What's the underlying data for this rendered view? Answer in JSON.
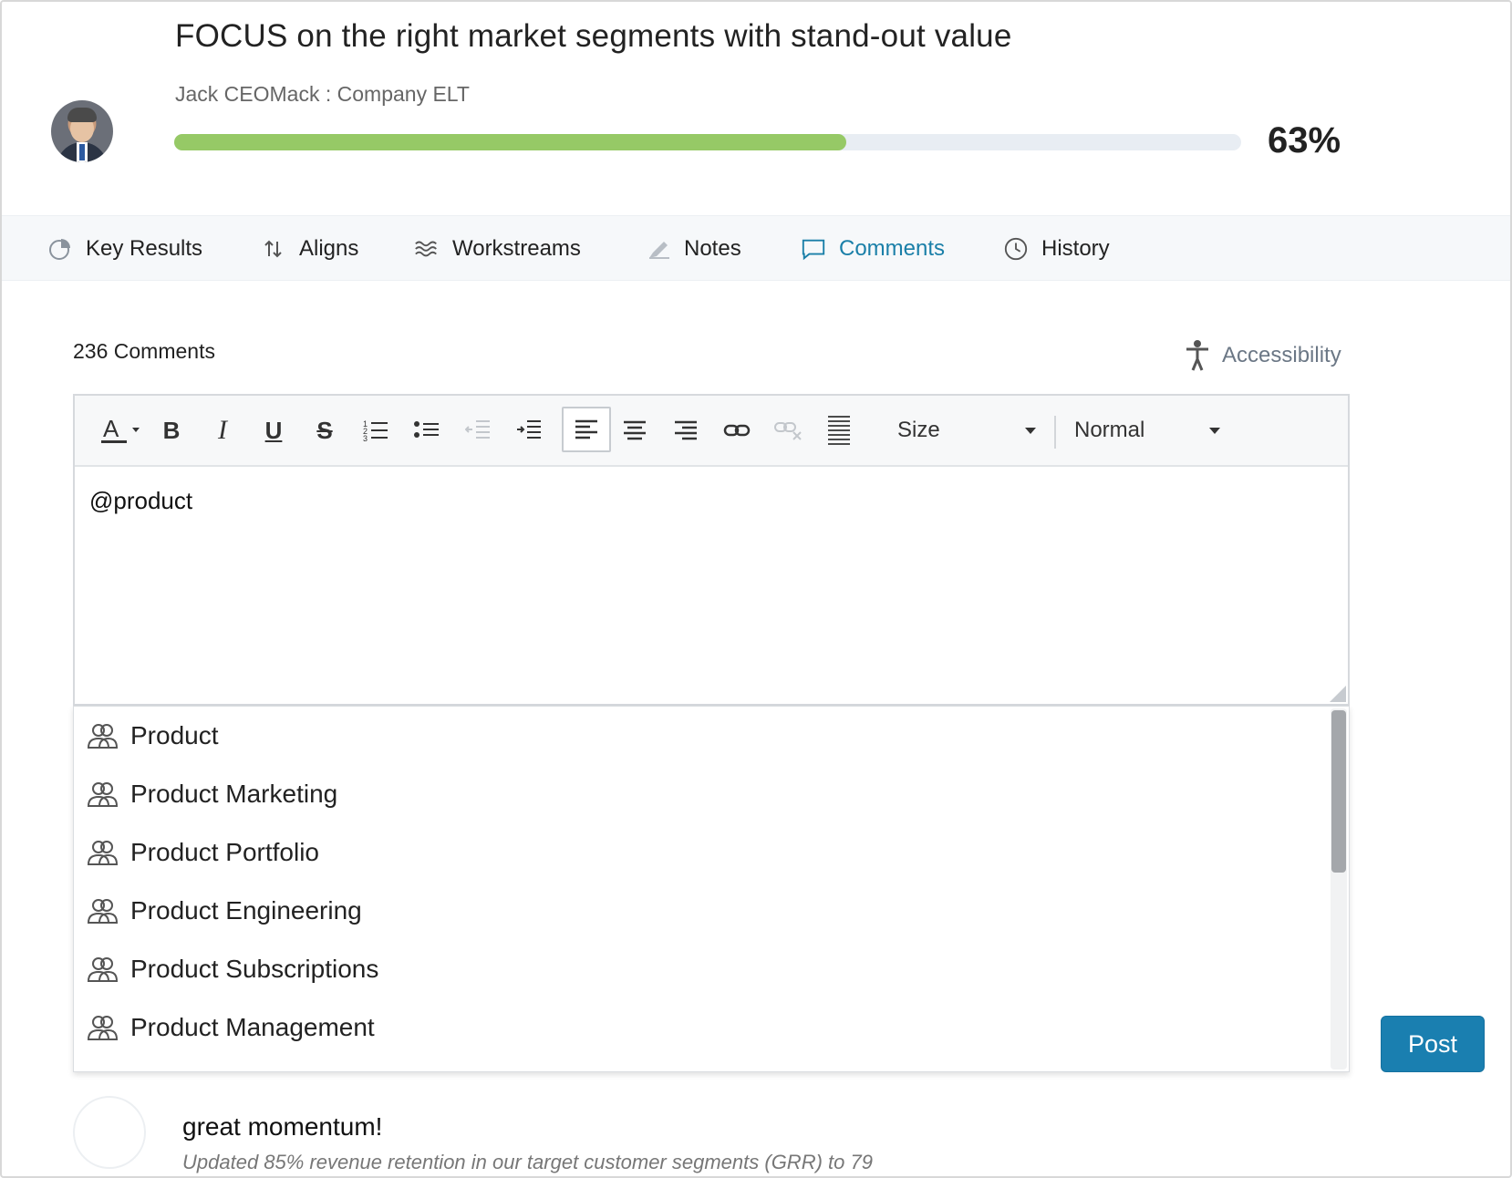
{
  "header": {
    "objective_title": "FOCUS on the right market segments with stand-out value",
    "owner": "Jack CEOMack : Company ELT",
    "progress_percent_value": 63,
    "progress_label": "63%"
  },
  "tabs": [
    {
      "label": "Key Results",
      "icon": "pie-chart-icon"
    },
    {
      "label": "Aligns",
      "icon": "align-arrows-icon"
    },
    {
      "label": "Workstreams",
      "icon": "waves-icon"
    },
    {
      "label": "Notes",
      "icon": "pen-icon"
    },
    {
      "label": "Comments",
      "icon": "speech-bubble-icon",
      "active": true
    },
    {
      "label": "History",
      "icon": "clock-icon"
    }
  ],
  "comments": {
    "count_label": "236 Comments",
    "accessibility_label": "Accessibility"
  },
  "editor": {
    "size_select": "Size",
    "format_select": "Normal",
    "content": "@product"
  },
  "mention_suggestions": [
    "Product",
    "Product Marketing",
    "Product Portfolio",
    "Product Engineering",
    "Product Subscriptions",
    "Product Management"
  ],
  "post_label": "Post",
  "previous_comment": {
    "title": "great momentum!",
    "subtitle": "Updated 85% revenue retention in our target customer segments (GRR) to 79"
  },
  "colors": {
    "accent": "#1a7fb0",
    "progress": "#96c966",
    "progress_track": "#e8edf3",
    "active_tab": "#1a7fa8"
  }
}
